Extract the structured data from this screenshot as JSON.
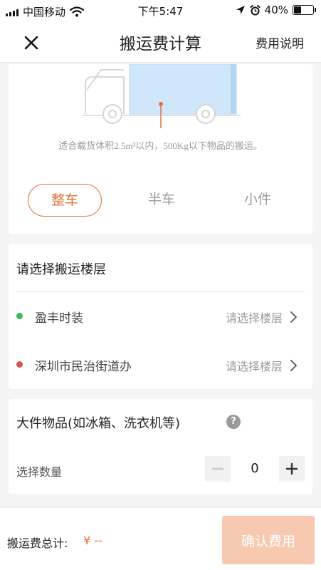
{
  "status_bar": {
    "carrier": "中国移动",
    "time": "下午5:47",
    "battery": "40%",
    "battery_level": 0.4
  },
  "nav": {
    "title": "搬运费计算",
    "action": "费用说明"
  },
  "vehicle": {
    "description": "适合载货体积2.5m³以内，500Kg以下物品的搬运。",
    "tabs": [
      "整车",
      "半车",
      "小件"
    ],
    "active_tab": 0
  },
  "floor": {
    "title": "请选择搬运楼层",
    "rows": [
      {
        "place": "盈丰时装",
        "select_label": "请选择楼层",
        "dot_color": "#3fb950"
      },
      {
        "place": "深圳市民治街道办",
        "select_label": "请选择楼层",
        "dot_color": "#d9534f"
      }
    ]
  },
  "large_items": {
    "title": "大件物品(如冰箱、洗衣机等)",
    "quantity_label": "选择数量",
    "quantity": "0"
  },
  "bottom": {
    "total_label": "搬运费总计:",
    "total_value": "¥ --",
    "confirm": "确认费用"
  },
  "colors": {
    "accent": "#e07438",
    "confirm_disabled": "#f7c9b1"
  }
}
